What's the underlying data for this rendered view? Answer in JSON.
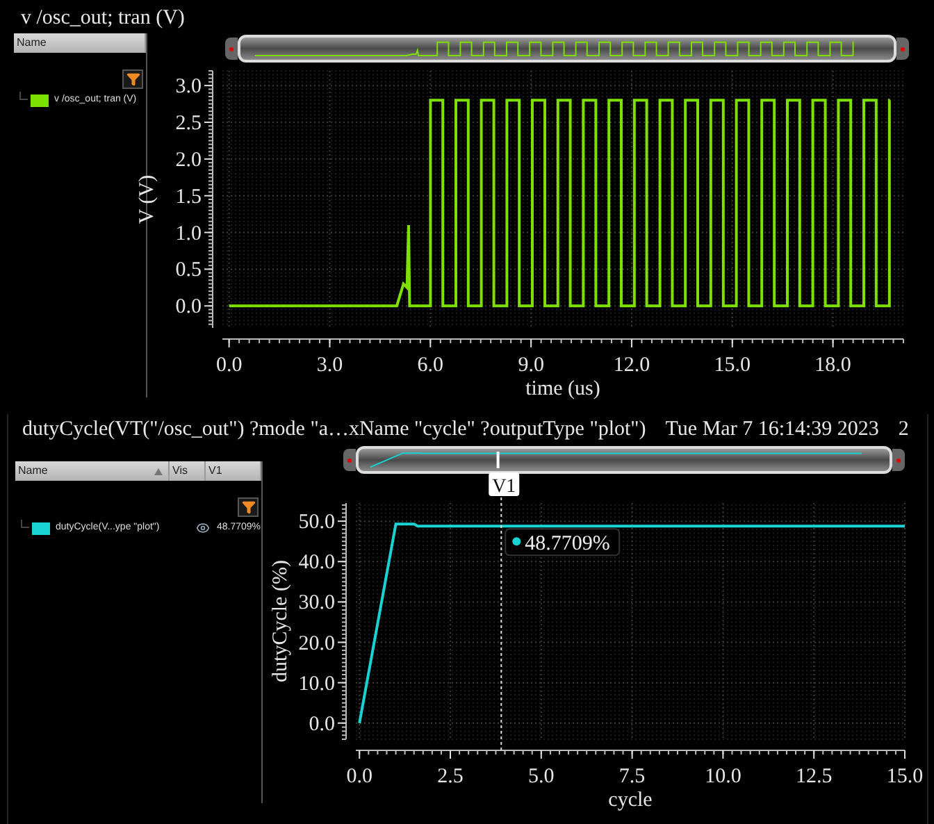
{
  "plots": [
    {
      "title": "v /osc_out; tran (V)",
      "legend": {
        "columns": [
          {
            "label": "Name",
            "sorted": false
          }
        ],
        "items": [
          {
            "name": "v /osc_out; tran (V)",
            "color": "#7ee000",
            "visible": false
          }
        ]
      },
      "chart_data": {
        "type": "line",
        "xlabel": "time (us)",
        "ylabel": "V (V)",
        "x": [
          0,
          5.0,
          5.2,
          5.3,
          5.35,
          5.38,
          6.0,
          6.0,
          6.37,
          6.37,
          6.76,
          6.76,
          7.13,
          7.13,
          7.52,
          7.52,
          7.89,
          7.89,
          8.28,
          8.28,
          8.65,
          8.65,
          9.04,
          9.04,
          9.41,
          9.41,
          9.8,
          9.8,
          10.17,
          10.17,
          10.56,
          10.56,
          10.93,
          10.93,
          11.32,
          11.32,
          11.69,
          11.69,
          12.08,
          12.08,
          12.45,
          12.45,
          12.84,
          12.84,
          13.21,
          13.21,
          13.6,
          13.6,
          13.97,
          13.97,
          14.36,
          14.36,
          14.73,
          14.73,
          15.12,
          15.12,
          15.49,
          15.49,
          15.88,
          15.88,
          16.25,
          16.25,
          16.64,
          16.64,
          17.01,
          17.01,
          17.4,
          17.4,
          17.77,
          17.77,
          18.16,
          18.16,
          18.53,
          18.53,
          18.92,
          18.92,
          19.29,
          19.29,
          19.68,
          19.68,
          19.7
        ],
        "grid": true,
        "series": [
          {
            "color": "#7ee000",
            "values": [
              0,
              0,
              0.3,
              0.25,
              1.1,
              0,
              0,
              2.8,
              2.8,
              0,
              0,
              2.8,
              2.8,
              0,
              0,
              2.8,
              2.8,
              0,
              0,
              2.8,
              2.8,
              0,
              0,
              2.8,
              2.8,
              0,
              0,
              2.8,
              2.8,
              0,
              0,
              2.8,
              2.8,
              0,
              0,
              2.8,
              2.8,
              0,
              0,
              2.8,
              2.8,
              0,
              0,
              2.8,
              2.8,
              0,
              0,
              2.8,
              2.8,
              0,
              0,
              2.8,
              2.8,
              0,
              0,
              2.8,
              2.8,
              0,
              0,
              2.8,
              2.8,
              0,
              0,
              2.8,
              2.8,
              0,
              0,
              2.8,
              2.8,
              0,
              0,
              2.8,
              2.8,
              0,
              0,
              2.8,
              2.8,
              0,
              0,
              2.8,
              2.8
            ]
          }
        ],
        "xlim": [
          -0.2,
          20.1
        ],
        "ylim": [
          -0.3,
          3.2
        ],
        "xticks": [
          {
            "value": 0,
            "label": "0.0"
          },
          {
            "value": 3,
            "label": "3.0"
          },
          {
            "value": 6,
            "label": "6.0"
          },
          {
            "value": 9,
            "label": "9.0"
          },
          {
            "value": 12,
            "label": "12.0"
          },
          {
            "value": 15,
            "label": "15.0"
          },
          {
            "value": 18,
            "label": "18.0"
          }
        ],
        "yticks": [
          {
            "value": 0,
            "label": "0.0"
          },
          {
            "value": 0.5,
            "label": "0.5"
          },
          {
            "value": 1,
            "label": "1.0"
          },
          {
            "value": 1.5,
            "label": "1.5"
          },
          {
            "value": 2,
            "label": "2.0"
          },
          {
            "value": 2.5,
            "label": "2.5"
          },
          {
            "value": 3,
            "label": "3.0"
          }
        ]
      }
    },
    {
      "title": "dutyCycle(VT(\"/osc_out\") ?mode \"a…xName \"cycle\" ?outputType \"plot\")",
      "timestamp": "Tue Mar 7 16:14:39 2023",
      "title_extra": "2",
      "legend": {
        "columns": [
          {
            "label": "Name",
            "sorted": true
          },
          {
            "label": "Vis",
            "sorted": false
          },
          {
            "label": "V1",
            "sorted": false
          }
        ],
        "items": [
          {
            "name": "dutyCycle(V...ype \"plot\")",
            "color": "#19d3d3",
            "visible": true,
            "value": "48.7709%"
          }
        ]
      },
      "chart_data": {
        "type": "line",
        "xlabel": "cycle",
        "ylabel": "dutyCycle (%)",
        "x": [
          0,
          1,
          1.5,
          1.6,
          15
        ],
        "grid": true,
        "series": [
          {
            "color": "#19d3d3",
            "values": [
              0,
              49.3,
              49.3,
              48.8,
              48.8
            ]
          }
        ],
        "xlim": [
          -0.1,
          15
        ],
        "ylim": [
          -4,
          54.5
        ],
        "xticks": [
          {
            "value": 0,
            "label": "0.0"
          },
          {
            "value": 2.5,
            "label": "2.5"
          },
          {
            "value": 5,
            "label": "5.0"
          },
          {
            "value": 7.5,
            "label": "7.5"
          },
          {
            "value": 10,
            "label": "10.0"
          },
          {
            "value": 12.5,
            "label": "12.5"
          },
          {
            "value": 15,
            "label": "15.0"
          }
        ],
        "yticks": [
          {
            "value": 0,
            "label": "0.0"
          },
          {
            "value": 10,
            "label": "10.0"
          },
          {
            "value": 20,
            "label": "20.0"
          },
          {
            "value": 30,
            "label": "30.0"
          },
          {
            "value": 40,
            "label": "40.0"
          },
          {
            "value": 50,
            "label": "50.0"
          }
        ],
        "ref_lines": [
          {
            "axis": "x",
            "value": 3.9,
            "label": "V1"
          }
        ],
        "annotations": [
          {
            "x": 3.9,
            "y": 48.77,
            "text": "48.7709%"
          }
        ]
      }
    }
  ]
}
